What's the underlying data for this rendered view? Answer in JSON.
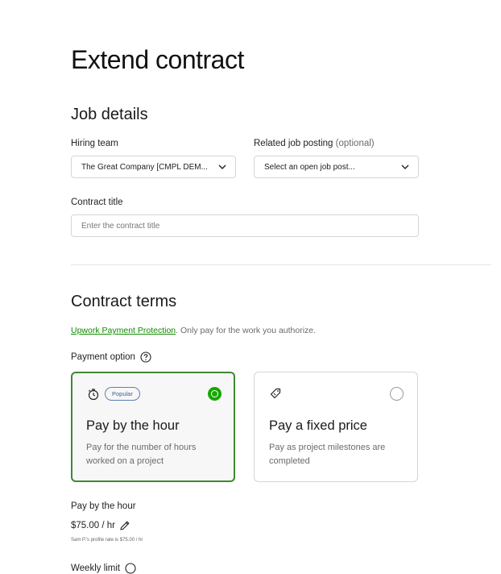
{
  "page": {
    "title": "Extend contract"
  },
  "job_details": {
    "heading": "Job details",
    "hiring_team": {
      "label": "Hiring team",
      "value": "The Great Company [CMPL DEM..."
    },
    "related_job": {
      "label": "Related job posting",
      "optional": "(optional)",
      "value": "Select an open job post..."
    },
    "contract_title": {
      "label": "Contract title",
      "placeholder": "Enter the contract title"
    }
  },
  "contract_terms": {
    "heading": "Contract terms",
    "protection_link": "Upwork Payment Protection",
    "protection_text": ". Only pay for the work you authorize.",
    "payment_option_label": "Payment option",
    "options": [
      {
        "badge": "Popular",
        "title": "Pay by the hour",
        "desc": "Pay for the number of hours worked on a project",
        "selected": true
      },
      {
        "title": "Pay a fixed price",
        "desc": "Pay as project milestones are completed",
        "selected": false
      }
    ],
    "hourly": {
      "label": "Pay by the hour",
      "rate": "$75.00 / hr",
      "profile_rate_note": "Sam P.'s profile rate is $75.00 / hr",
      "weekly_limit_label": "Weekly limit"
    }
  },
  "colors": {
    "accent": "#14a800",
    "link": "#108a00",
    "badge": "#3a5c96"
  }
}
